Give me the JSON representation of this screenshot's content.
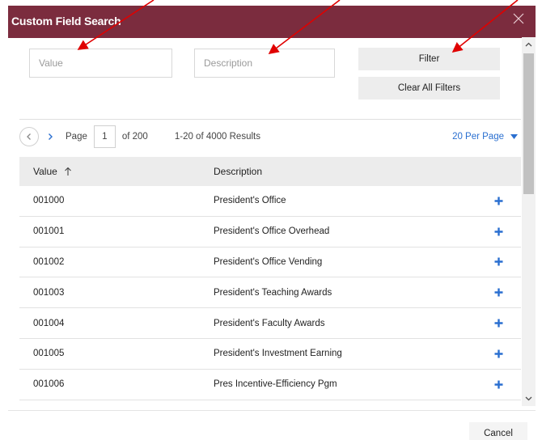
{
  "dialog": {
    "title": "Custom Field Search",
    "close_icon": "close-icon"
  },
  "filters": {
    "value_placeholder": "Value",
    "description_placeholder": "Description",
    "filter_label": "Filter",
    "clear_label": "Clear All Filters"
  },
  "pager": {
    "prev_icon": "chevron-left-icon",
    "next_icon": "chevron-right-icon",
    "page_label": "Page",
    "page_number": "1",
    "of_label": "of 200",
    "results": "1-20 of 4000 Results",
    "per_page": "20 Per Page",
    "per_page_icon": "caret-down-icon"
  },
  "table": {
    "headers": {
      "value": "Value",
      "description": "Description"
    },
    "sort_icon": "sort-up-arrow-icon",
    "rows": [
      {
        "value": "001000",
        "description": "President's Office"
      },
      {
        "value": "001001",
        "description": "President's Office Overhead"
      },
      {
        "value": "001002",
        "description": "President's Office Vending"
      },
      {
        "value": "001003",
        "description": "President's Teaching Awards"
      },
      {
        "value": "001004",
        "description": "President's Faculty Awards"
      },
      {
        "value": "001005",
        "description": "President's Investment Earning"
      },
      {
        "value": "001006",
        "description": "Pres Incentive-Efficiency Pgm"
      }
    ],
    "add_icon": "plus-icon"
  },
  "footer": {
    "cancel_label": "Cancel"
  },
  "colors": {
    "title_bar": "#7b2c3e",
    "accent_blue": "#2a6fd0",
    "annotation_red": "#e00000"
  }
}
